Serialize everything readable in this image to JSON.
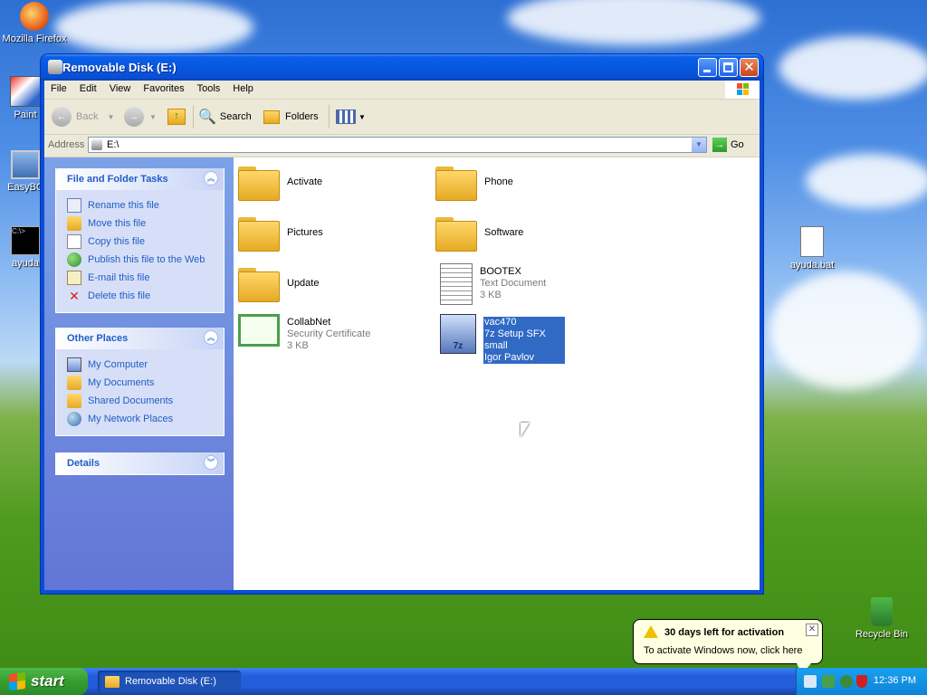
{
  "desktop": {
    "icons": [
      {
        "label": "Mozilla Firefox"
      },
      {
        "label": "Paint"
      },
      {
        "label": "EasyBC"
      },
      {
        "label": "ayuda"
      },
      {
        "label": "ayuda.bat"
      },
      {
        "label": "Recycle Bin"
      }
    ]
  },
  "window": {
    "title": "Removable Disk (E:)",
    "menu": [
      "File",
      "Edit",
      "View",
      "Favorites",
      "Tools",
      "Help"
    ],
    "toolbar": {
      "back": "Back",
      "search": "Search",
      "folders": "Folders"
    },
    "address": {
      "label": "Address",
      "value": "E:\\",
      "go": "Go"
    }
  },
  "left_pane": {
    "file_tasks": {
      "title": "File and Folder Tasks",
      "items": [
        "Rename this file",
        "Move this file",
        "Copy this file",
        "Publish this file to the Web",
        "E-mail this file",
        "Delete this file"
      ]
    },
    "other_places": {
      "title": "Other Places",
      "items": [
        "My Computer",
        "My Documents",
        "Shared Documents",
        "My Network Places"
      ]
    },
    "details": {
      "title": "Details"
    }
  },
  "files": [
    {
      "name": "Activate",
      "type": "folder"
    },
    {
      "name": "Phone",
      "type": "folder"
    },
    {
      "name": "Pictures",
      "type": "folder"
    },
    {
      "name": "Software",
      "type": "folder"
    },
    {
      "name": "Update",
      "type": "folder"
    },
    {
      "name": "BOOTEX",
      "desc": "Text Document",
      "size": "3 KB",
      "type": "text"
    },
    {
      "name": "CollabNet",
      "desc": "Security Certificate",
      "size": "3 KB",
      "type": "cert"
    },
    {
      "name": "vac470",
      "desc": "7z Setup SFX small",
      "size": "Igor Pavlov",
      "type": "exe",
      "selected": true
    }
  ],
  "taskbar": {
    "start": "start",
    "task": "Removable Disk (E:)",
    "clock": "12:36 PM"
  },
  "balloon": {
    "title": "30 days left for activation",
    "text": "To activate Windows now, click here"
  }
}
